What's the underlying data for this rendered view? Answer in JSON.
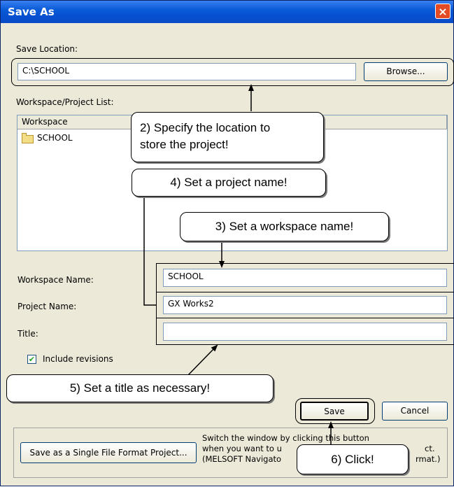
{
  "window": {
    "title": "Save As",
    "close_glyph": "×"
  },
  "save_location": {
    "label": "Save Location:",
    "value": "C:\\SCHOOL",
    "browse_label": "Browse..."
  },
  "project_list": {
    "label": "Workspace/Project List:",
    "column_header": "Workspace",
    "items": [
      {
        "name": "SCHOOL",
        "icon": "folder-icon"
      }
    ]
  },
  "fields": {
    "workspace_label": "Workspace Name:",
    "workspace_value": "SCHOOL",
    "project_label": "Project Name:",
    "project_value": "GX Works2",
    "title_label": "Title:",
    "title_value": ""
  },
  "include_revisions": {
    "label": "Include revisions",
    "checked": true,
    "check_glyph": "✔"
  },
  "buttons": {
    "save": "Save",
    "cancel": "Cancel",
    "single_file": "Save as a Single File Format Project..."
  },
  "single_file_description": [
    "Switch the window by clicking this button",
    "when you want to u",
    "ct.",
    "(MELSOFT Navigato",
    "rmat.)"
  ],
  "callouts": {
    "location": [
      "2) Specify the location to",
      "store the project!"
    ],
    "project": "4) Set a project name!",
    "workspace": "3) Set a workspace name!",
    "title": "5) Set a title as necessary!",
    "click": "6) Click!"
  }
}
